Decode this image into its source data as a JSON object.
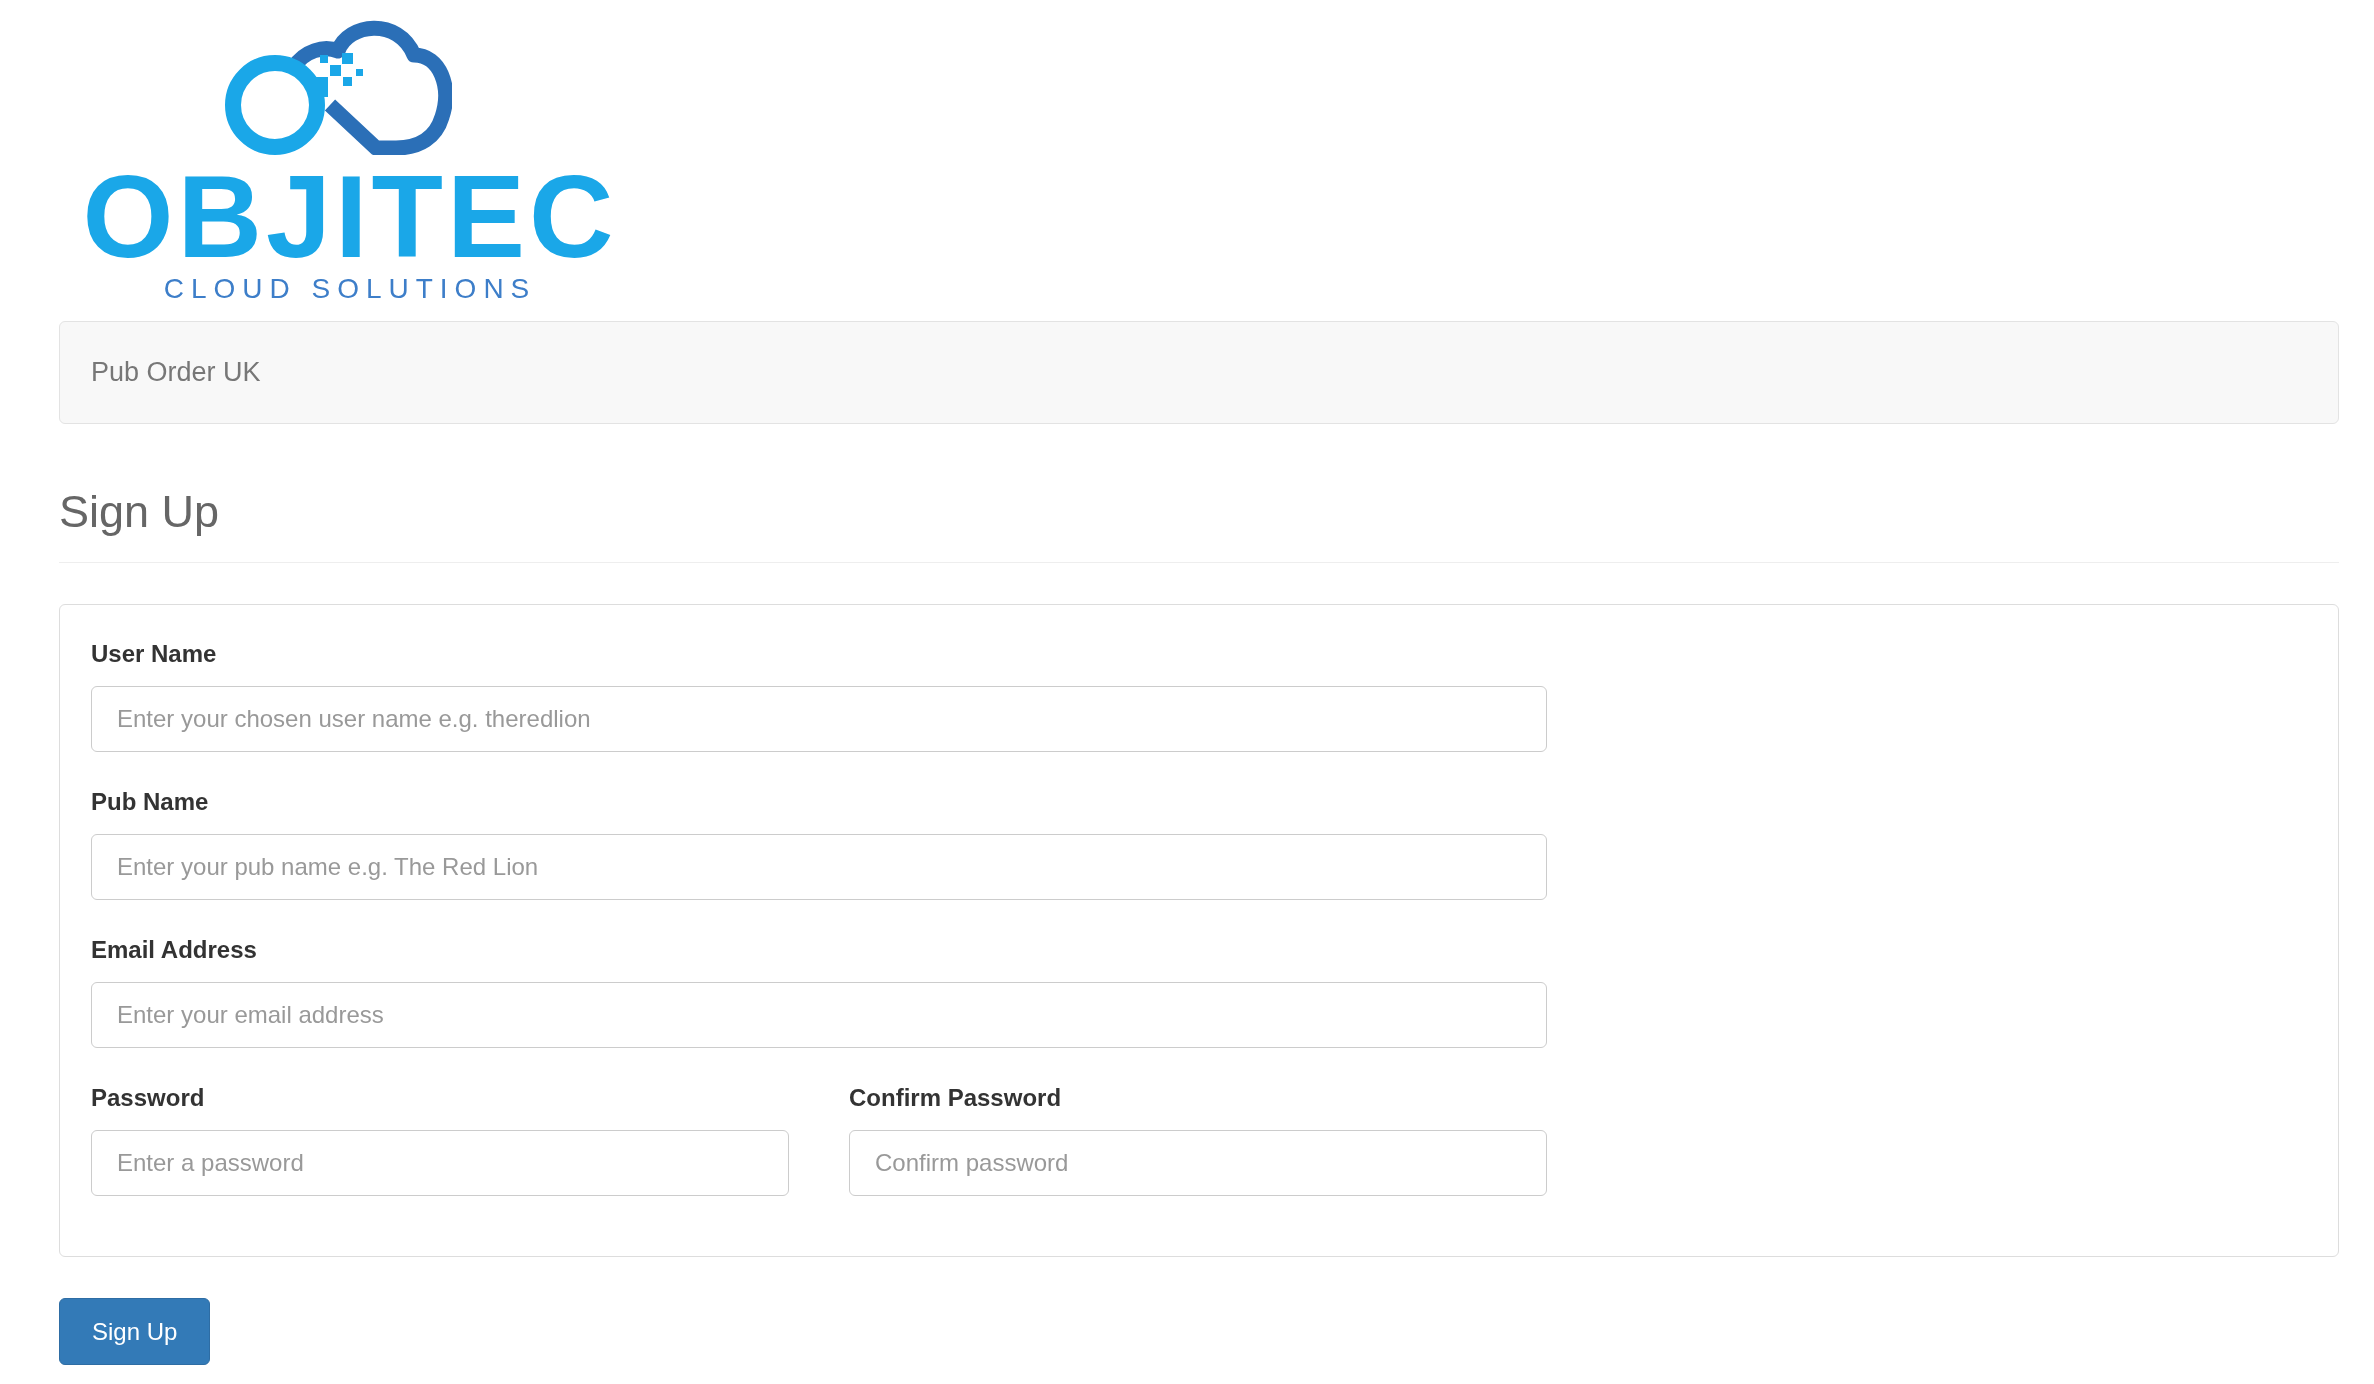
{
  "logo": {
    "wordmark": "OBJITEC",
    "tagline": "CLOUD SOLUTIONS"
  },
  "navbar": {
    "brand": "Pub Order UK"
  },
  "page_header": {
    "title": "Sign Up"
  },
  "form": {
    "rows": [
      {
        "fields": [
          {
            "label": "User Name",
            "placeholder": "Enter your chosen user name e.g. theredlion"
          }
        ]
      },
      {
        "fields": [
          {
            "label": "Pub Name",
            "placeholder": "Enter your pub name e.g. The Red Lion"
          }
        ]
      },
      {
        "fields": [
          {
            "label": "Email Address",
            "placeholder": "Enter your email address"
          }
        ]
      },
      {
        "fields": [
          {
            "label": "Password",
            "placeholder": "Enter a password"
          },
          {
            "label": "Confirm Password",
            "placeholder": "Confirm password"
          }
        ]
      }
    ]
  },
  "submit_button": {
    "label": "Sign Up"
  }
}
